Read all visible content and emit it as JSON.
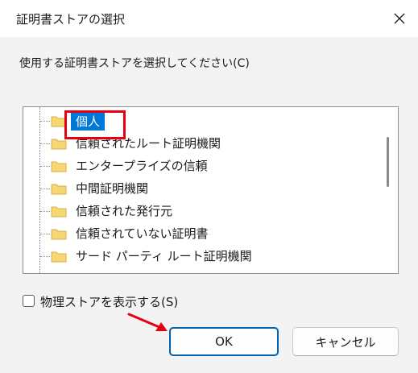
{
  "dialog": {
    "title": "証明書ストアの選択",
    "prompt": "使用する証明書ストアを選択してください(C)",
    "tree": {
      "items": [
        {
          "label": "個人",
          "selected": true
        },
        {
          "label": "信頼されたルート証明機関"
        },
        {
          "label": "エンタープライズの信頼"
        },
        {
          "label": "中間証明機関"
        },
        {
          "label": "信頼された発行元"
        },
        {
          "label": "信頼されていない証明書"
        },
        {
          "label": "サード パーティ ルート証明機関"
        }
      ]
    },
    "checkbox_label": "物理ストアを表示する(S)",
    "ok_label": "OK",
    "cancel_label": "キャンセル"
  },
  "colors": {
    "selection": "#0078d7",
    "annotation_red": "#e60012",
    "folder_yellow": "#f7d774"
  },
  "icons": [
    "close-icon",
    "folder-icon",
    "annotation-arrow-icon"
  ]
}
